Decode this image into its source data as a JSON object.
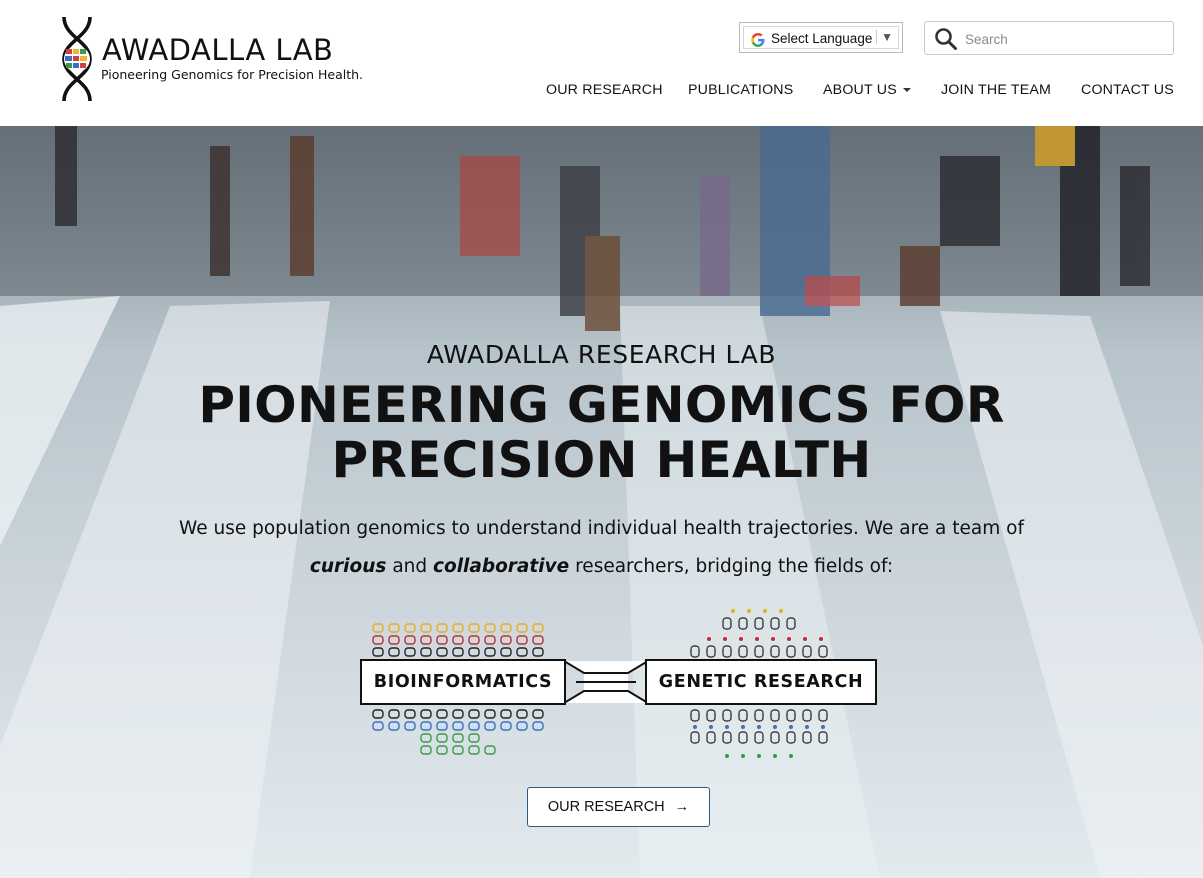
{
  "header": {
    "logo_title": "AWADALLA LAB",
    "logo_tagline": "Pioneering Genomics for Precision Health.",
    "language_label": "Select Language",
    "language_arrow": "▼",
    "search_placeholder": "Search",
    "nav": [
      {
        "label": "OUR RESEARCH"
      },
      {
        "label": "PUBLICATIONS"
      },
      {
        "label": "ABOUT US",
        "has_dropdown": true
      },
      {
        "label": "JOIN THE TEAM"
      },
      {
        "label": "CONTACT US"
      }
    ]
  },
  "hero": {
    "kicker": "AWADALLA RESEARCH LAB",
    "headline_line1": "PIONEERING GENOMICS FOR",
    "headline_line2": "PRECISION HEALTH",
    "para_line1": "We use population genomics to understand individual health trajectories. We are a team of",
    "para_word1": "curious",
    "para_and": "and",
    "para_word2": "collaborative",
    "para_rest": "researchers, bridging the fields of:",
    "field_left": "BIOINFORMATICS",
    "field_right": "GENETIC RESEARCH",
    "cta_label": "OUR RESEARCH",
    "cta_arrow": "→"
  },
  "icons": [
    "dna-logo-icon",
    "google-icon",
    "search-icon",
    "dna-grid-icon",
    "people-grid-icon",
    "connector-icon",
    "arrow-right-icon"
  ],
  "colors": {
    "cta_border": "#2a5a8a",
    "text": "#111111",
    "hero_sky": "#dde6ec"
  }
}
